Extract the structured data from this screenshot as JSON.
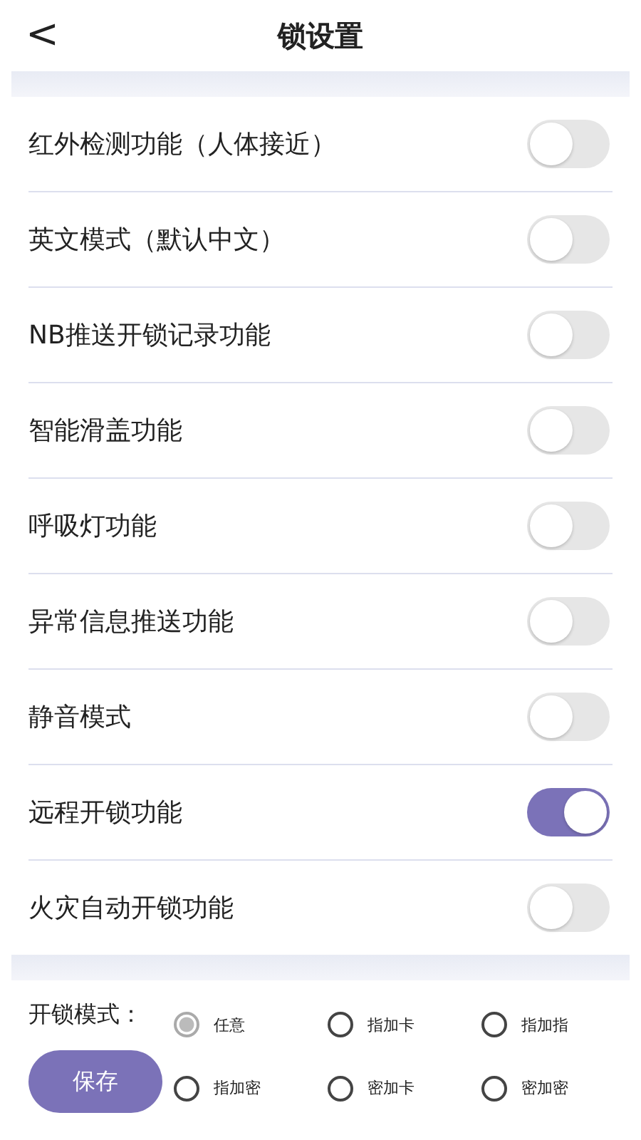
{
  "header": {
    "back": "<",
    "title": "锁设置"
  },
  "settings": [
    {
      "label": "红外检测功能（人体接近）",
      "on": false
    },
    {
      "label": "英文模式（默认中文）",
      "on": false
    },
    {
      "label": "NB推送开锁记录功能",
      "on": false
    },
    {
      "label": "智能滑盖功能",
      "on": false
    },
    {
      "label": "呼吸灯功能",
      "on": false
    },
    {
      "label": "异常信息推送功能",
      "on": false
    },
    {
      "label": "静音模式",
      "on": false
    },
    {
      "label": "远程开锁功能",
      "on": true
    },
    {
      "label": "火灾自动开锁功能",
      "on": false
    }
  ],
  "unlock_mode": {
    "label": "开锁模式：",
    "options": [
      {
        "label": "任意",
        "selected": true
      },
      {
        "label": "指加卡",
        "selected": false
      },
      {
        "label": "指加指",
        "selected": false
      },
      {
        "label": "指加密",
        "selected": false
      },
      {
        "label": "密加卡",
        "selected": false
      },
      {
        "label": "密加密",
        "selected": false
      }
    ],
    "save": "保存"
  }
}
